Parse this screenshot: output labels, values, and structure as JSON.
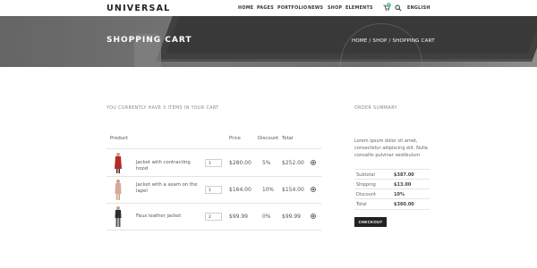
{
  "header": {
    "logo": "UNIVERSAL",
    "nav": [
      "HOME",
      "PAGES",
      "PORTFOLIO",
      "NEWS",
      "SHOP",
      "ELEMENTS"
    ],
    "cart_count": "3",
    "language": "ENGLISH"
  },
  "hero": {
    "title": "SHOPPING CART",
    "breadcrumb": "HOME / SHOP / SHOPPING CART"
  },
  "cart": {
    "intro": "YOU CURRENTLY HAVE 3 ITEMS IN YOUR CART",
    "columns": [
      "Product",
      "Price",
      "Discount",
      "Total"
    ],
    "items": [
      {
        "name": "Jacket with contracting hood",
        "qty": "1",
        "price": "$280.00",
        "discount": "5%",
        "total": "$252.00",
        "color": "#b52a2a"
      },
      {
        "name": "Jacket with a seam on the lapel",
        "qty": "1",
        "price": "$164.00",
        "discount": "10%",
        "total": "$154.00",
        "color": "#d9a89a"
      },
      {
        "name": "Faux leather jacket",
        "qty": "2",
        "price": "$99.99",
        "discount": "0%",
        "total": "$99.99",
        "color": "#2e2e2e"
      }
    ]
  },
  "summary": {
    "heading": "ORDER SUMMARY",
    "text": "Lorem ipsum dolor sit amet, consectetur adipiscing elit. Nulla convallis pulvinar vestibulum",
    "rows": [
      {
        "label": "Subtotal",
        "value": "$387.00"
      },
      {
        "label": "Shipping",
        "value": "$13.00"
      },
      {
        "label": "Discount",
        "value": "10%"
      },
      {
        "label": "Total",
        "value": "$360.00"
      }
    ],
    "checkout_label": "CHECKOUT"
  },
  "colors": {
    "accent": "#4fbfa8",
    "dark": "#222222"
  }
}
